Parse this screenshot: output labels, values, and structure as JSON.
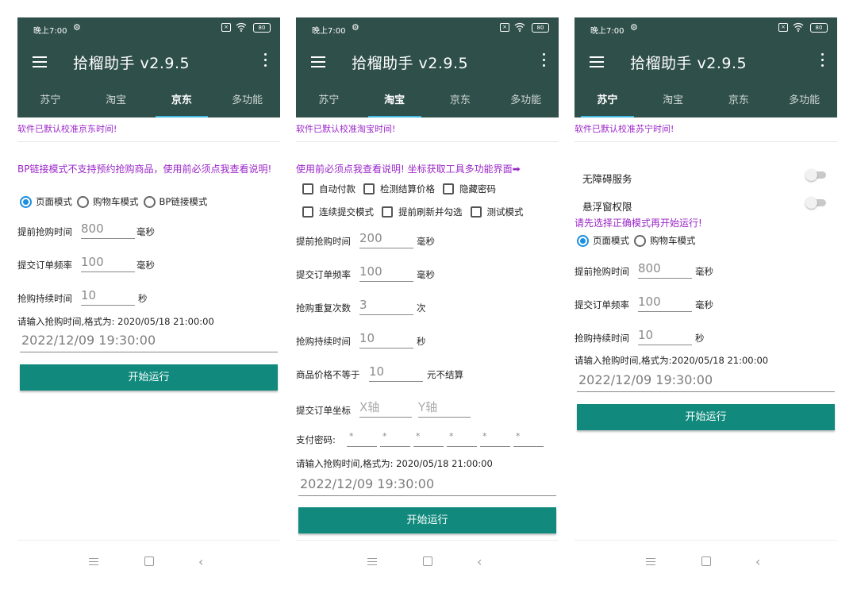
{
  "status": {
    "time": "晚上7:00",
    "battery": "80"
  },
  "app_title": "拾榴助手  v2.9.5",
  "tabs": [
    "苏宁",
    "淘宝",
    "京东",
    "多功能"
  ],
  "jd": {
    "notice": "软件已默认校准京东时间!",
    "warning": "BP链接模式不支持预约抢购商品，使用前必须点我查看说明!",
    "modes": [
      "页面模式",
      "购物车模式",
      "BP链接模式"
    ],
    "selected_mode": "页面模式",
    "advance_label": "提前抢购时间",
    "advance_value": "800",
    "advance_unit": "毫秒",
    "freq_label": "提交订单频率",
    "freq_value": "100",
    "freq_unit": "毫秒",
    "duration_label": "抢购持续时间",
    "duration_value": "10",
    "duration_unit": "秒",
    "format_hint": "请输入抢购时间,格式为: 2020/05/18 21:00:00",
    "datetime": "2022/12/09 19:30:00",
    "start_button": "开始运行"
  },
  "taobao": {
    "notice": "软件已默认校准淘宝时间!",
    "warning": "使用前必须点我查看说明! 坐标获取工具多功能界面➡",
    "checkboxes_row1": [
      "自动付款",
      "检测结算价格",
      "隐藏密码"
    ],
    "checkboxes_row2": [
      "连续提交模式",
      "提前刷新并勾选",
      "测试模式"
    ],
    "advance_label": "提前抢购时间",
    "advance_value": "200",
    "advance_unit": "毫秒",
    "freq_label": "提交订单频率",
    "freq_value": "100",
    "freq_unit": "毫秒",
    "repeat_label": "抢购重复次数",
    "repeat_value": "3",
    "repeat_unit": "次",
    "duration_label": "抢购持续时间",
    "duration_value": "10",
    "duration_unit": "秒",
    "price_label": "商品价格不等于",
    "price_value": "10",
    "price_unit": "元不结算",
    "coord_label": "提交订单坐标",
    "coord_x_placeholder": "X轴",
    "coord_y_placeholder": "Y轴",
    "password_label": "支付密码:",
    "password_digits": [
      "*",
      "*",
      "*",
      "*",
      "*",
      "*"
    ],
    "format_hint": "请输入抢购时间,格式为: 2020/05/18 21:00:00",
    "datetime": "2022/12/09 19:30:00",
    "start_button": "开始运行"
  },
  "suning": {
    "notice": "软件已默认校准苏宁时间!",
    "accessibility_label": "无障碍服务",
    "overlay_label": "悬浮窗权限",
    "mode_warning": "请先选择正确模式再开始运行!",
    "modes": [
      "页面模式",
      "购物车模式"
    ],
    "selected_mode": "页面模式",
    "advance_label": "提前抢购时间",
    "advance_value": "800",
    "advance_unit": "毫秒",
    "freq_label": "提交订单频率",
    "freq_value": "100",
    "freq_unit": "毫秒",
    "duration_label": "抢购持续时间",
    "duration_value": "10",
    "duration_unit": "秒",
    "format_hint": "请输入抢购时间,格式为:2020/05/18 21:00:00",
    "datetime": "2022/12/09 19:30:00",
    "start_button": "开始运行"
  }
}
